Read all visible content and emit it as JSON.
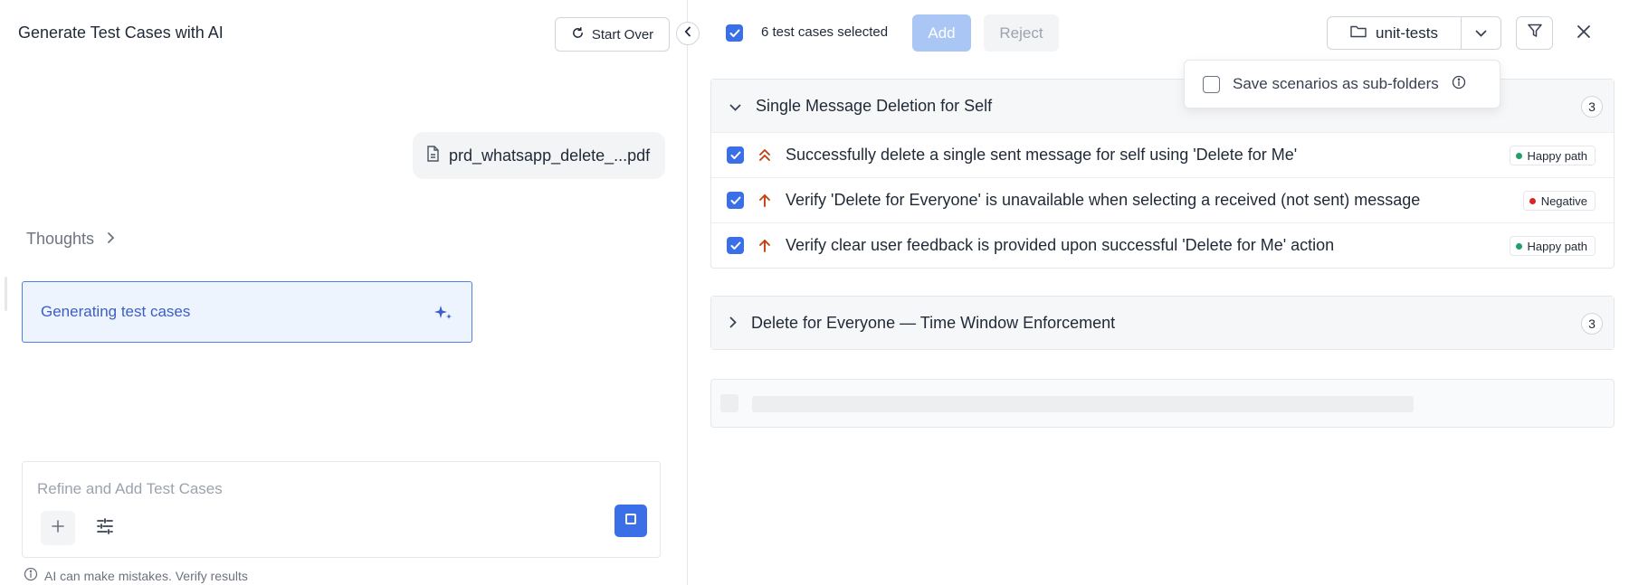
{
  "left_panel": {
    "title": "Generate Test Cases with AI",
    "start_over_label": "Start Over",
    "file_name": "prd_whatsapp_delete_...pdf",
    "thoughts_label": "Thoughts",
    "status_label": "Generating test cases",
    "composer": {
      "placeholder": "Refine and Add Test Cases"
    },
    "disclaimer": "AI can make mistakes. Verify results"
  },
  "toolbar": {
    "selection_text": "6 test cases selected",
    "add_label": "Add",
    "reject_label": "Reject",
    "folder_name": "unit-tests"
  },
  "popover": {
    "option_label": "Save scenarios as sub-folders",
    "checked": false
  },
  "scenarios": [
    {
      "title": "Single Message Deletion for Self",
      "count": "3",
      "expanded": true,
      "cases": [
        {
          "title": "Successfully delete a single sent message for self using 'Delete for Me'",
          "priority": "highest",
          "tag": "Happy path",
          "tag_color": "#22a06b"
        },
        {
          "title": "Verify 'Delete for Everyone' is unavailable when selecting a received (not sent) message",
          "priority": "high",
          "tag": "Negative",
          "tag_color": "#dc2626"
        },
        {
          "title": "Verify clear user feedback is provided upon successful 'Delete for Me' action",
          "priority": "high",
          "tag": "Happy path",
          "tag_color": "#22a06b"
        }
      ]
    },
    {
      "title": "Delete for Everyone — Time Window Enforcement",
      "count": "3",
      "expanded": false
    }
  ],
  "colors": {
    "accent": "#3b6fe8",
    "priority": "#c2410c",
    "generating_border": "#4f7ee8",
    "generating_bg": "#eef4fd"
  },
  "icons": [
    "refresh-icon",
    "chevron-left-icon",
    "file-icon",
    "chevron-right-icon",
    "sparkle-icon",
    "plus-icon",
    "tune-icon",
    "stop-icon",
    "info-icon",
    "check-icon",
    "folder-icon",
    "chevron-down-icon",
    "filter-icon",
    "close-icon",
    "priority-highest-icon",
    "priority-high-icon"
  ]
}
